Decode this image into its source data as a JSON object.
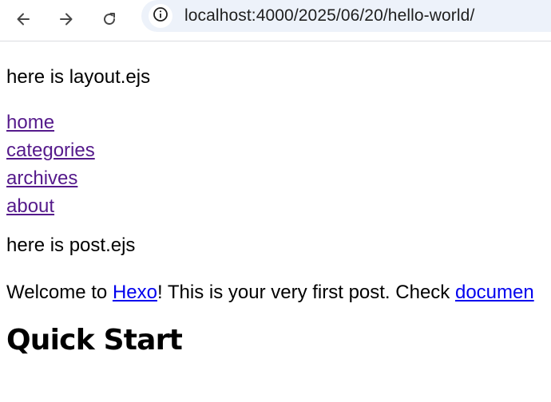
{
  "browser": {
    "url": "localhost:4000/2025/06/20/hello-world/",
    "icons": {
      "back": "arrow-left-icon",
      "forward": "arrow-right-icon",
      "reload": "reload-icon",
      "site_info": "info-icon"
    }
  },
  "page": {
    "layout_note": "here is layout.ejs",
    "nav": [
      {
        "label": "home"
      },
      {
        "label": "categories"
      },
      {
        "label": "archives"
      },
      {
        "label": "about"
      }
    ],
    "post_note": "here is post.ejs",
    "intro": {
      "before": "Welcome to ",
      "link1": "Hexo",
      "middle": "! This is your very first post. Check ",
      "link2": "documen"
    },
    "heading": "Quick Start"
  },
  "colors": {
    "visited_link": "#551a8b",
    "link": "#0000ee",
    "omnibox_bg": "#edf2fa"
  }
}
